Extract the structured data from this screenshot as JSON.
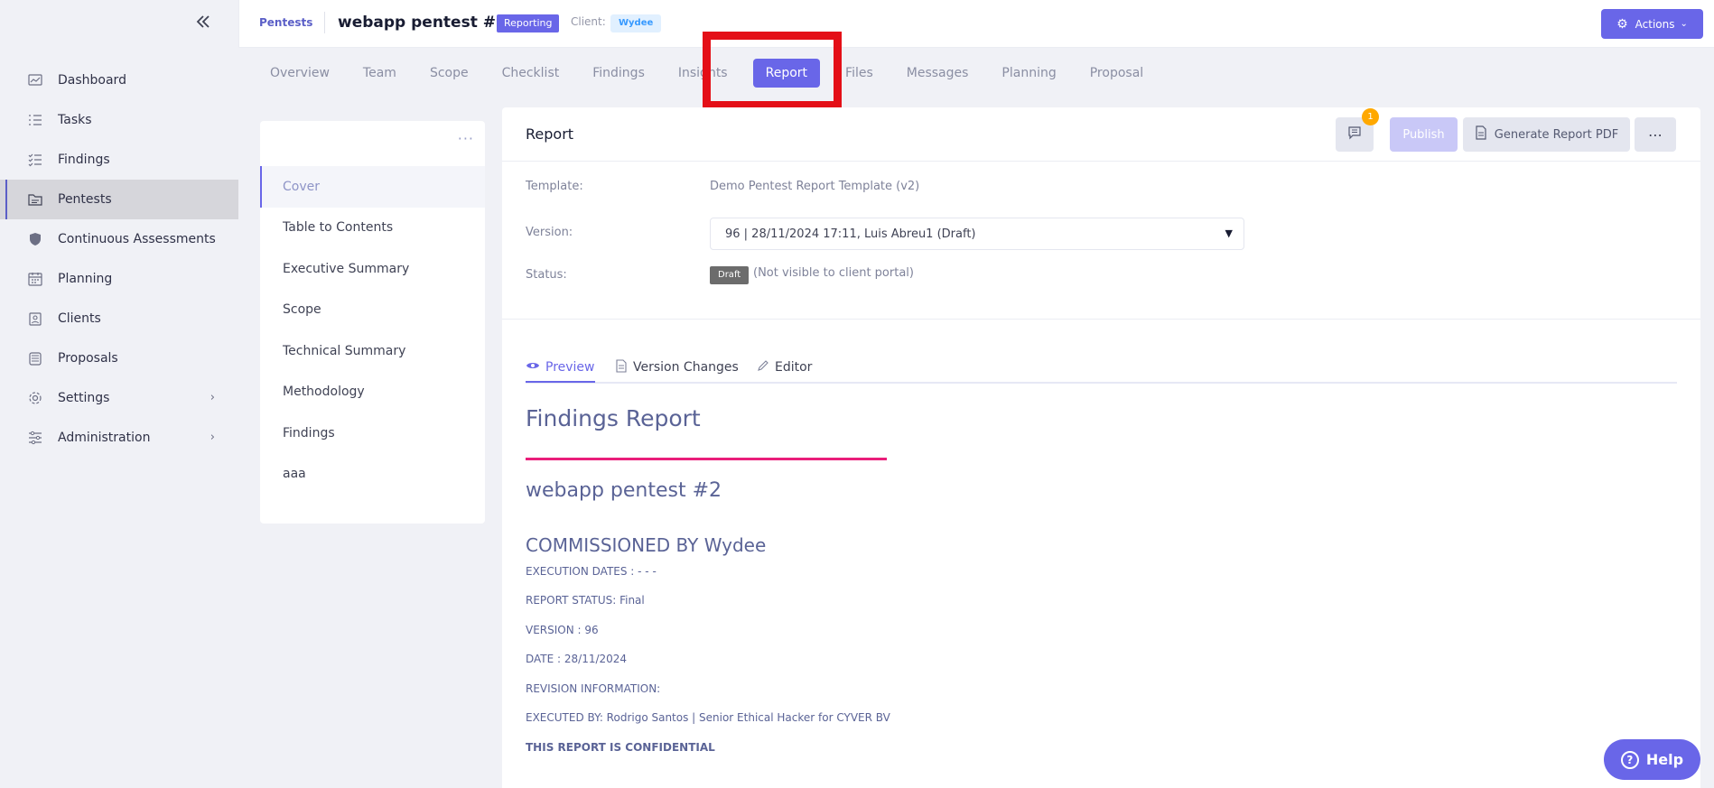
{
  "sidebar": {
    "collapse_icon": "chevrons-left-icon",
    "items": [
      {
        "label": "Dashboard",
        "icon": "chart-icon"
      },
      {
        "label": "Tasks",
        "icon": "list-icon"
      },
      {
        "label": "Findings",
        "icon": "checklist-icon"
      },
      {
        "label": "Pentests",
        "icon": "folder-icon"
      },
      {
        "label": "Continuous Assessments",
        "icon": "shield-icon"
      },
      {
        "label": "Planning",
        "icon": "calendar-icon"
      },
      {
        "label": "Clients",
        "icon": "clipboard-icon"
      },
      {
        "label": "Proposals",
        "icon": "stack-icon"
      },
      {
        "label": "Settings",
        "icon": "gear-icon"
      },
      {
        "label": "Administration",
        "icon": "sliders-icon"
      }
    ],
    "active": "Pentests"
  },
  "header": {
    "breadcrumb": "Pentests",
    "title": "webapp pentest #2",
    "status": "Reporting",
    "client_label": "Client:",
    "client": "Wydee",
    "actions_label": "Actions"
  },
  "tabs": [
    "Overview",
    "Team",
    "Scope",
    "Checklist",
    "Findings",
    "Insights",
    "Report",
    "Files",
    "Messages",
    "Planning",
    "Proposal"
  ],
  "active_tab": "Report",
  "sections": [
    "Cover",
    "Table to Contents",
    "Executive Summary",
    "Scope",
    "Technical Summary",
    "Methodology",
    "Findings",
    "aaa"
  ],
  "active_section": "Cover",
  "report": {
    "title": "Report",
    "comment_count": "1",
    "publish_label": "Publish",
    "generate_pdf_label": "Generate Report PDF",
    "more_label": "⋯",
    "template_label": "Template:",
    "template_value": "Demo Pentest Report Template (v2)",
    "version_label": "Version:",
    "version_value": "96 | 28/11/2024 17:11, Luis Abreu1 (Draft)",
    "status_label": "Status:",
    "status_badge": "Draft",
    "status_note": "(Not visible to client portal)"
  },
  "view_tabs": {
    "preview": "Preview",
    "version_changes": "Version Changes",
    "editor": "Editor"
  },
  "preview": {
    "title": "Findings Report",
    "subtitle": "webapp pentest #2",
    "commissioned": "COMMISSIONED BY Wydee",
    "lines": [
      "EXECUTION DATES : - - -",
      "REPORT STATUS: Final",
      "VERSION : 96",
      "DATE : 28/11/2024",
      "REVISION INFORMATION:",
      "EXECUTED BY: Rodrigo Santos | Senior Ethical Hacker for CYVER BV",
      "THIS REPORT IS CONFIDENTIAL"
    ]
  },
  "help_label": "Help",
  "colors": {
    "accent": "#6966e8",
    "highlight": "#e40f17",
    "rule": "#e91e7a"
  }
}
